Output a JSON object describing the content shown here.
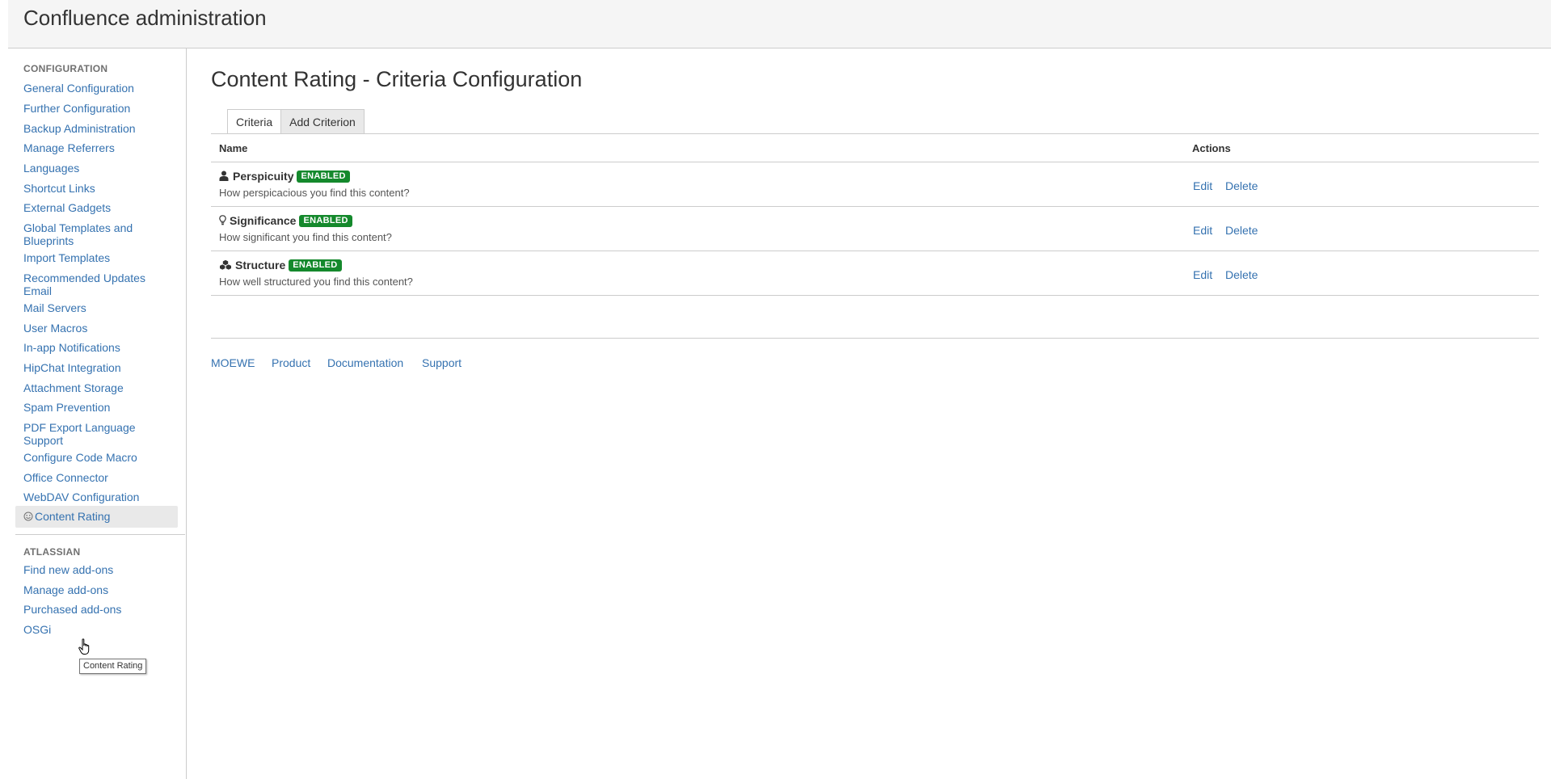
{
  "header": {
    "title": "Confluence administration"
  },
  "sidebar": {
    "config_heading": "CONFIGURATION",
    "items": [
      {
        "label": "General Configuration"
      },
      {
        "label": "Further Configuration"
      },
      {
        "label": "Backup Administration"
      },
      {
        "label": "Manage Referrers"
      },
      {
        "label": "Languages"
      },
      {
        "label": "Shortcut Links"
      },
      {
        "label": "External Gadgets"
      },
      {
        "label": "Global Templates and Blueprints"
      },
      {
        "label": "Import Templates"
      },
      {
        "label": "Recommended Updates Email"
      },
      {
        "label": "Mail Servers"
      },
      {
        "label": "User Macros"
      },
      {
        "label": "In-app Notifications"
      },
      {
        "label": "HipChat Integration"
      },
      {
        "label": "Attachment Storage"
      },
      {
        "label": "Spam Prevention"
      },
      {
        "label": "PDF Export Language Support"
      },
      {
        "label": "Configure Code Macro"
      },
      {
        "label": "Office Connector"
      },
      {
        "label": "WebDAV Configuration"
      },
      {
        "label": "Content Rating",
        "icon": "smiley-icon",
        "selected": true
      }
    ],
    "atlassian_heading": "ATLASSIAN",
    "atlassian_items": [
      {
        "label": "Find new add-ons"
      },
      {
        "label": "Manage add-ons"
      },
      {
        "label": "Purchased add-ons"
      },
      {
        "label": "OSGi"
      }
    ],
    "tooltip": "Content Rating"
  },
  "main": {
    "title": "Content Rating - Criteria Configuration",
    "tabs": [
      {
        "label": "Criteria",
        "active": true
      },
      {
        "label": "Add Criterion",
        "active": false
      }
    ],
    "table": {
      "headers": {
        "name": "Name",
        "actions": "Actions"
      },
      "rows": [
        {
          "name": "Perspicuity",
          "icon": "user-icon",
          "status": "ENABLED",
          "description": "How perspicacious you find this content?",
          "edit": "Edit",
          "delete": "Delete"
        },
        {
          "name": "Significance",
          "icon": "lightbulb-icon",
          "status": "ENABLED",
          "description": "How significant you find this content?",
          "edit": "Edit",
          "delete": "Delete"
        },
        {
          "name": "Structure",
          "icon": "cubes-icon",
          "status": "ENABLED",
          "description": "How well structured you find this content?",
          "edit": "Edit",
          "delete": "Delete"
        }
      ]
    },
    "footer_links": [
      "MOEWE",
      "Product",
      "Documentation",
      "Support"
    ]
  },
  "colors": {
    "link": "#3572b0",
    "badge": "#14892c",
    "header_bg": "#f5f5f5"
  }
}
